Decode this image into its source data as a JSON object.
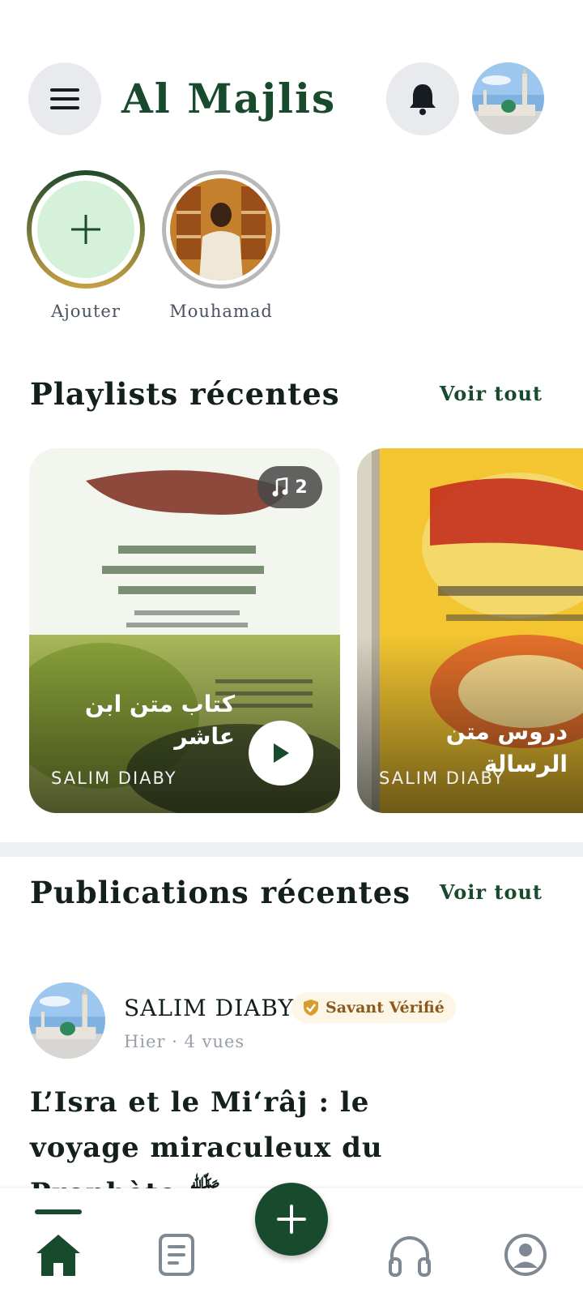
{
  "header": {
    "title": "Al Majlis",
    "menu_icon": "hamburger-menu-icon",
    "bell_icon": "bell-icon",
    "profile_icon": "profile-avatar-mosque"
  },
  "stories": [
    {
      "label": "Ajouter",
      "icon": "plus-icon"
    },
    {
      "label": "Mouhamad",
      "icon": "person-photo"
    }
  ],
  "playlists": {
    "title": "Playlists récentes",
    "see_all": "Voir tout",
    "items": [
      {
        "title": "كتاب متن ابن عاشر",
        "author": "SALIM DIABY",
        "count": "2"
      },
      {
        "title": "دروس متن الرسالة",
        "author": "SALIM DIABY"
      }
    ]
  },
  "publications": {
    "title": "Publications récentes",
    "see_all": "Voir tout",
    "post": {
      "author": "SALIM DIABY",
      "badge": "Savant Vérifié",
      "meta": "Hier · 4 vues",
      "title": "L’Isra et le Mi‘râj : le voyage miraculeux du Prophète ﷺ"
    }
  },
  "nav": {
    "items": [
      "home-icon",
      "document-icon",
      "add-icon",
      "headphones-icon",
      "profile-icon"
    ]
  },
  "colors": {
    "primary": "#184a2d",
    "add_story_fill": "#d6f1d9",
    "badge_bg": "#fdf6e6",
    "badge_text": "#8a5a1c",
    "divider": "#eff0f4"
  }
}
